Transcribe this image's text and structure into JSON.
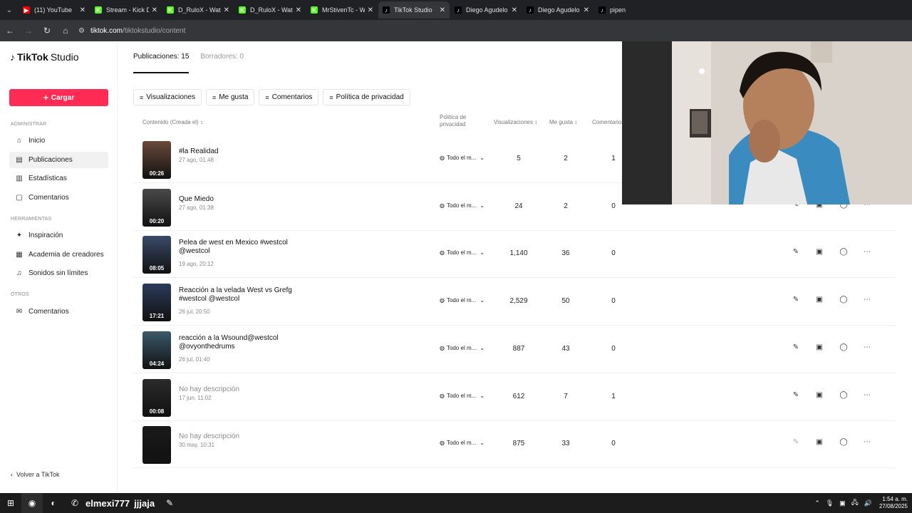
{
  "browser": {
    "tabs": [
      {
        "title": "(11) YouTube",
        "favicon": "youtube-icon",
        "color": "#ff0000",
        "active": false
      },
      {
        "title": "Stream - Kick D",
        "favicon": "kick-icon",
        "color": "#53fc18",
        "active": false
      },
      {
        "title": "D_RuloX - Wat",
        "favicon": "kick-icon",
        "color": "#53fc18",
        "active": false
      },
      {
        "title": "D_RuloX - Wat",
        "favicon": "kick-icon",
        "color": "#53fc18",
        "active": false
      },
      {
        "title": "MrStivenTc - W",
        "favicon": "kick-icon",
        "color": "#53fc18",
        "active": false
      },
      {
        "title": "TikTok Studio",
        "favicon": "tiktok-icon",
        "color": "#000000",
        "active": true
      },
      {
        "title": "Diego Agudelo",
        "favicon": "tiktok-icon",
        "color": "#000000",
        "active": false
      },
      {
        "title": "Diego Agudelo",
        "favicon": "tiktok-icon",
        "color": "#000000",
        "active": false
      },
      {
        "title": "pipen",
        "favicon": "tiktok-icon",
        "color": "#000000",
        "active": false
      }
    ],
    "url_domain": "tiktok.com",
    "url_path": "/tiktokstudio/content"
  },
  "sidebar": {
    "brand": "TikTok",
    "brand_suffix": "Studio",
    "upload_label": "Cargar",
    "section_admin": "ADMINISTRAR",
    "admin_items": [
      {
        "label": "Inicio",
        "icon": "home-icon",
        "active": false
      },
      {
        "label": "Publicaciones",
        "icon": "posts-icon",
        "active": true
      },
      {
        "label": "Estadísticas",
        "icon": "chart-icon",
        "active": false
      },
      {
        "label": "Comentarios",
        "icon": "comment-icon",
        "active": false
      }
    ],
    "section_tools": "HERRAMIENTAS",
    "tool_items": [
      {
        "label": "Inspiración",
        "icon": "lightbulb-icon"
      },
      {
        "label": "Academia de creadores",
        "icon": "academy-icon"
      },
      {
        "label": "Sonidos sin límites",
        "icon": "music-icon"
      }
    ],
    "section_other": "OTROS",
    "other_items": [
      {
        "label": "Comentarios",
        "icon": "mail-icon"
      }
    ],
    "back_label": "Volver a TikTok"
  },
  "content": {
    "tab_posts": "Publicaciones: 15",
    "tab_drafts": "Borradores: 0",
    "filters": [
      "Visualizaciones",
      "Me gusta",
      "Comentarios",
      "Política de privacidad"
    ],
    "columns": {
      "content": "Contenido (Creada el)",
      "privacy_line1": "Política de",
      "privacy_line2": "privacidad",
      "views": "Visualizaciones",
      "likes": "Me gusta",
      "comments": "Comentarios"
    },
    "rows": [
      {
        "title": "#la Realidad",
        "date": "27 ago, 01:48",
        "duration": "00:26",
        "privacy": "Todo el m...",
        "views": "5",
        "likes": "2",
        "comments": "1",
        "muted": false,
        "thumb_color": "#6b4a3a"
      },
      {
        "title": "Que Miedo",
        "date": "27 ago, 01:38",
        "duration": "00:20",
        "privacy": "Todo el m...",
        "views": "24",
        "likes": "2",
        "comments": "0",
        "muted": false,
        "thumb_color": "#4a4a4a"
      },
      {
        "title": "Pelea de west en Mexico #westcol @westcol",
        "date": "19 ago, 20:12",
        "duration": "08:05",
        "privacy": "Todo el m...",
        "views": "1,140",
        "likes": "36",
        "comments": "0",
        "muted": false,
        "thumb_color": "#3a4a6a"
      },
      {
        "title": "Reacción a la velada West vs Grefg #westcol @westcol",
        "date": "26 jul, 20:50",
        "duration": "17:21",
        "privacy": "Todo el m...",
        "views": "2,529",
        "likes": "50",
        "comments": "0",
        "muted": false,
        "thumb_color": "#2a3a5a"
      },
      {
        "title": "reacción a la Wsound@westcol @ovyonthedrums",
        "date": "26 jul, 01:40",
        "duration": "04:24",
        "privacy": "Todo el m...",
        "views": "887",
        "likes": "43",
        "comments": "0",
        "muted": false,
        "thumb_color": "#3a5a6a"
      },
      {
        "title": "No hay descripción",
        "date": "17 jun, 11:02",
        "duration": "00:08",
        "privacy": "Todo el m...",
        "views": "612",
        "likes": "7",
        "comments": "1",
        "muted": true,
        "thumb_color": "#2a2a2a"
      },
      {
        "title": "No hay descripción",
        "date": "30 may, 10:31",
        "duration": "",
        "privacy": "Todo el m...",
        "views": "875",
        "likes": "33",
        "comments": "0",
        "muted": true,
        "thumb_color": "#1a1a1a"
      }
    ]
  },
  "taskbar": {
    "text1": "elmexi777",
    "text2": "jjjaja",
    "time": "1:54 a. m.",
    "date": "27/08/2025"
  },
  "colors": {
    "accent": "#fe2c55"
  }
}
